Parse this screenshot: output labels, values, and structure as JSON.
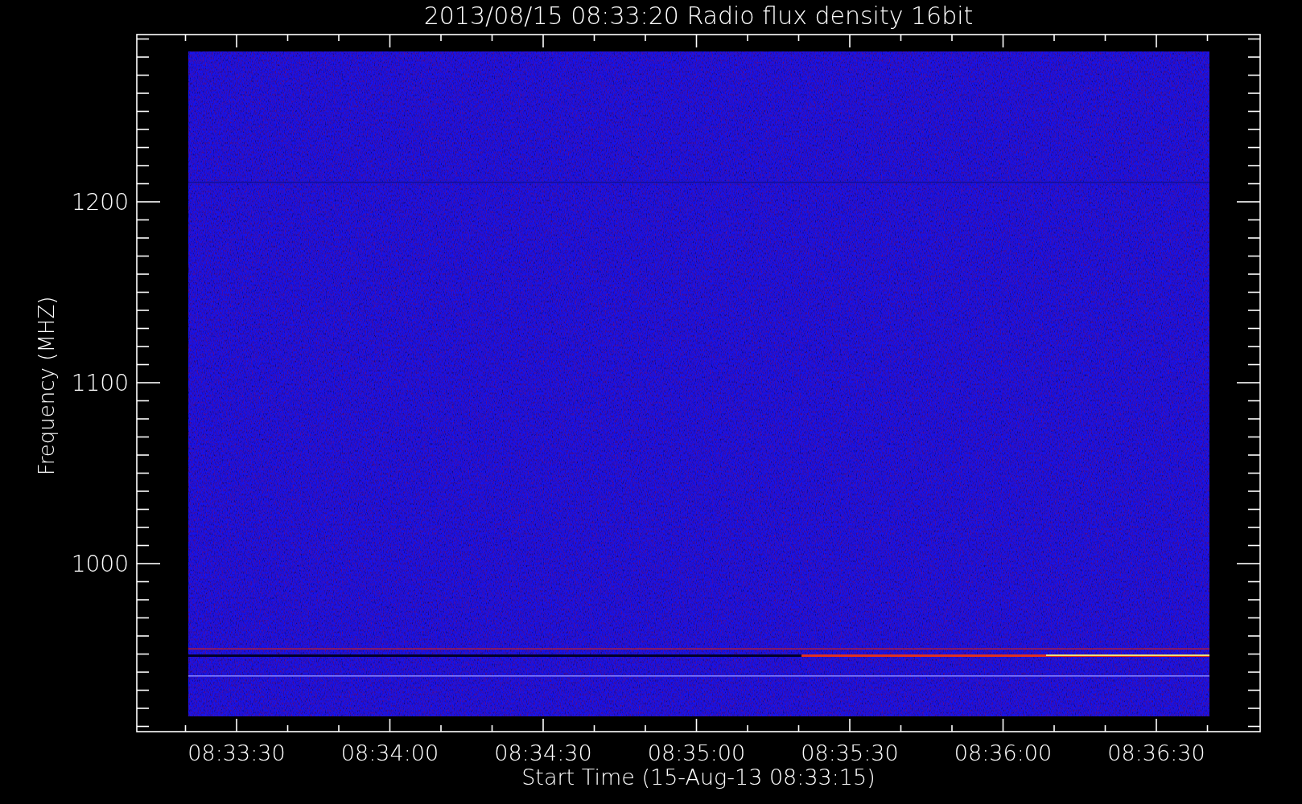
{
  "plot": {
    "title": "2013/08/15 08:33:20 Radio flux density 16bit",
    "ylabel": "Frequency (MHZ)",
    "xlabel": "Start Time (15-Aug-13 08:33:15)",
    "yticks": [
      "1200",
      "1100",
      "1000"
    ],
    "xticks": [
      "08:33:30",
      "08:34:00",
      "08:34:30",
      "08:35:00",
      "08:35:30",
      "08:36:00",
      "08:36:30"
    ]
  }
}
